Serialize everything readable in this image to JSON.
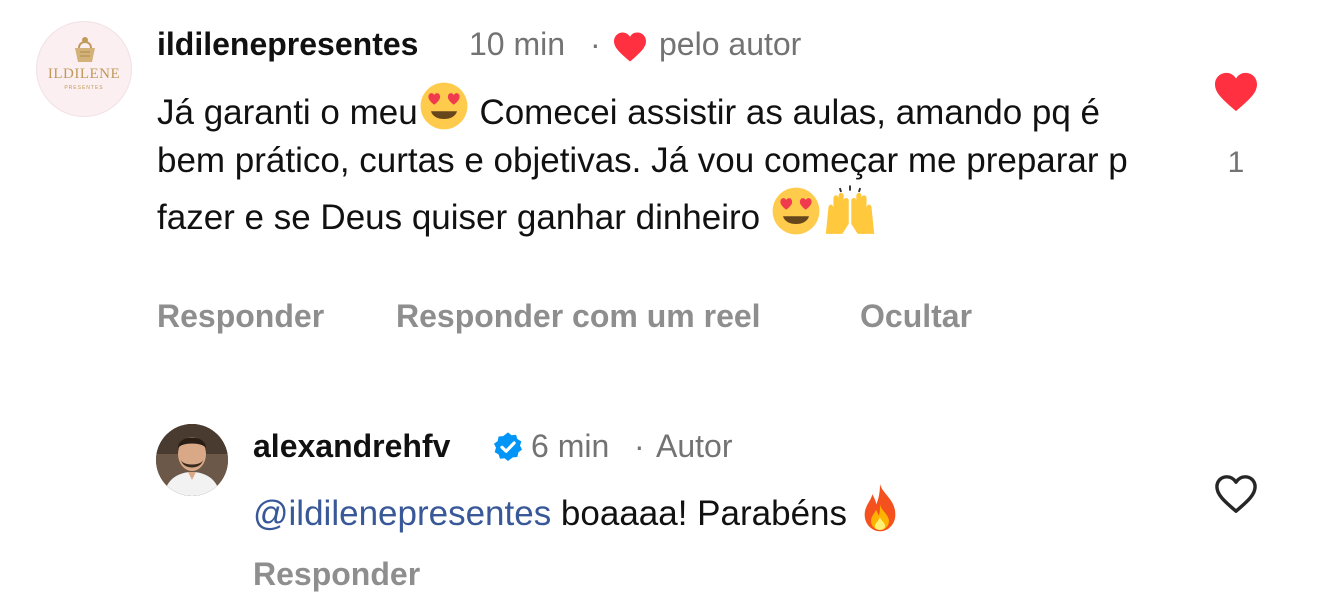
{
  "comment": {
    "avatar_brand_text": "ILDILENE",
    "avatar_brand_sub": "PRESENTES",
    "username": "ildilenepresentes",
    "time": "10 min",
    "separator": "·",
    "liked_by_author_label": "pelo autor",
    "text_part1": "Já garanti o meu",
    "text_part2": " Comecei assistir as aulas, amando pq é bem prático, curtas e objetivas. Já vou começar me preparar p fazer e se Deus quiser ganhar dinheiro ",
    "emojis": [
      "heart-eyes-emoji",
      "heart-eyes-emoji",
      "raising-hands-emoji"
    ],
    "like_count": "1",
    "liked": true,
    "actions": {
      "reply": "Responder",
      "reply_with_reel": "Responder com um reel",
      "hide": "Ocultar"
    }
  },
  "reply": {
    "username": "alexandrehfv",
    "verified": true,
    "time": "6 min",
    "separator": "·",
    "author_label": "Autor",
    "mention": "@ildilenepresentes",
    "text": " boaaaa! Parabéns ",
    "emojis": [
      "fire-emoji"
    ],
    "liked": false,
    "actions": {
      "reply": "Responder"
    }
  },
  "colors": {
    "like_red": "#ff3040",
    "verified_blue": "#0095f6",
    "mention_blue": "#385898",
    "secondary_text": "#737373",
    "action_text": "#8e8e8e"
  }
}
